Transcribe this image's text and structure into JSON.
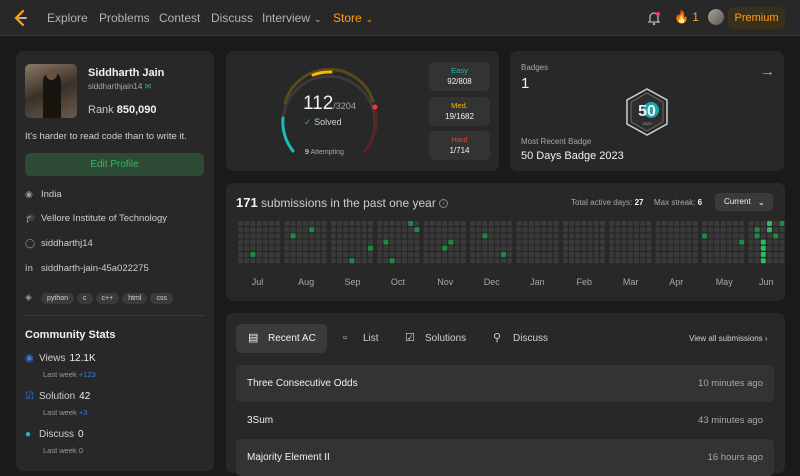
{
  "nav": {
    "items": [
      "Explore",
      "Problems",
      "Contest",
      "Discuss",
      "Interview",
      "Store"
    ],
    "streak": "1",
    "premium": "Premium"
  },
  "profile": {
    "name": "Siddharth Jain",
    "username": "siddharthjain14",
    "rank_label": "Rank",
    "rank": "850,090",
    "bio": "It's harder to read code than to write it.",
    "edit": "Edit Profile",
    "location": "India",
    "school": "Vellore Institute of Technology",
    "github": "siddharthj14",
    "linkedin": "siddharth-jain-45a022275",
    "skills": [
      "python",
      "c",
      "c++",
      "html",
      "css"
    ]
  },
  "community": {
    "title": "Community Stats",
    "views": {
      "label": "Views",
      "value": "12.1K",
      "delta": "+123"
    },
    "solution": {
      "label": "Solution",
      "value": "42",
      "delta": "+3"
    },
    "discuss": {
      "label": "Discuss",
      "value": "0",
      "delta": "0"
    },
    "last_week": "Last week"
  },
  "solved": {
    "count": "112",
    "total": "/3204",
    "label": "Solved",
    "attempting_num": "9",
    "attempting": "Attempting",
    "easy": {
      "label": "Easy",
      "value": "92/808",
      "color": "#1cbaba"
    },
    "medium": {
      "label": "Med.",
      "value": "19/1682",
      "color": "#ffb700"
    },
    "hard": {
      "label": "Hard",
      "value": "1/714",
      "color": "#f63737"
    }
  },
  "badges": {
    "label": "Badges",
    "count": "1",
    "recent_label": "Most Recent Badge",
    "recent_name": "50 Days Badge 2023",
    "badge_text": "50",
    "badge_year": "2023"
  },
  "submissions": {
    "count": "171",
    "text": "submissions in the past one year",
    "active_label": "Total active days:",
    "active": "27",
    "streak_label": "Max streak:",
    "streak": "6",
    "range": "Current",
    "months": [
      "Jul",
      "Aug",
      "Sep",
      "Oct",
      "Nov",
      "Dec",
      "Jan",
      "Feb",
      "Mar",
      "Apr",
      "May",
      "Jun"
    ]
  },
  "recent": {
    "tabs": [
      "Recent AC",
      "List",
      "Solutions",
      "Discuss"
    ],
    "view_all": "View all submissions",
    "rows": [
      {
        "name": "Three Consecutive Odds",
        "time": "10 minutes ago"
      },
      {
        "name": "3Sum",
        "time": "43 minutes ago"
      },
      {
        "name": "Majority Element II",
        "time": "16 hours ago"
      }
    ]
  }
}
